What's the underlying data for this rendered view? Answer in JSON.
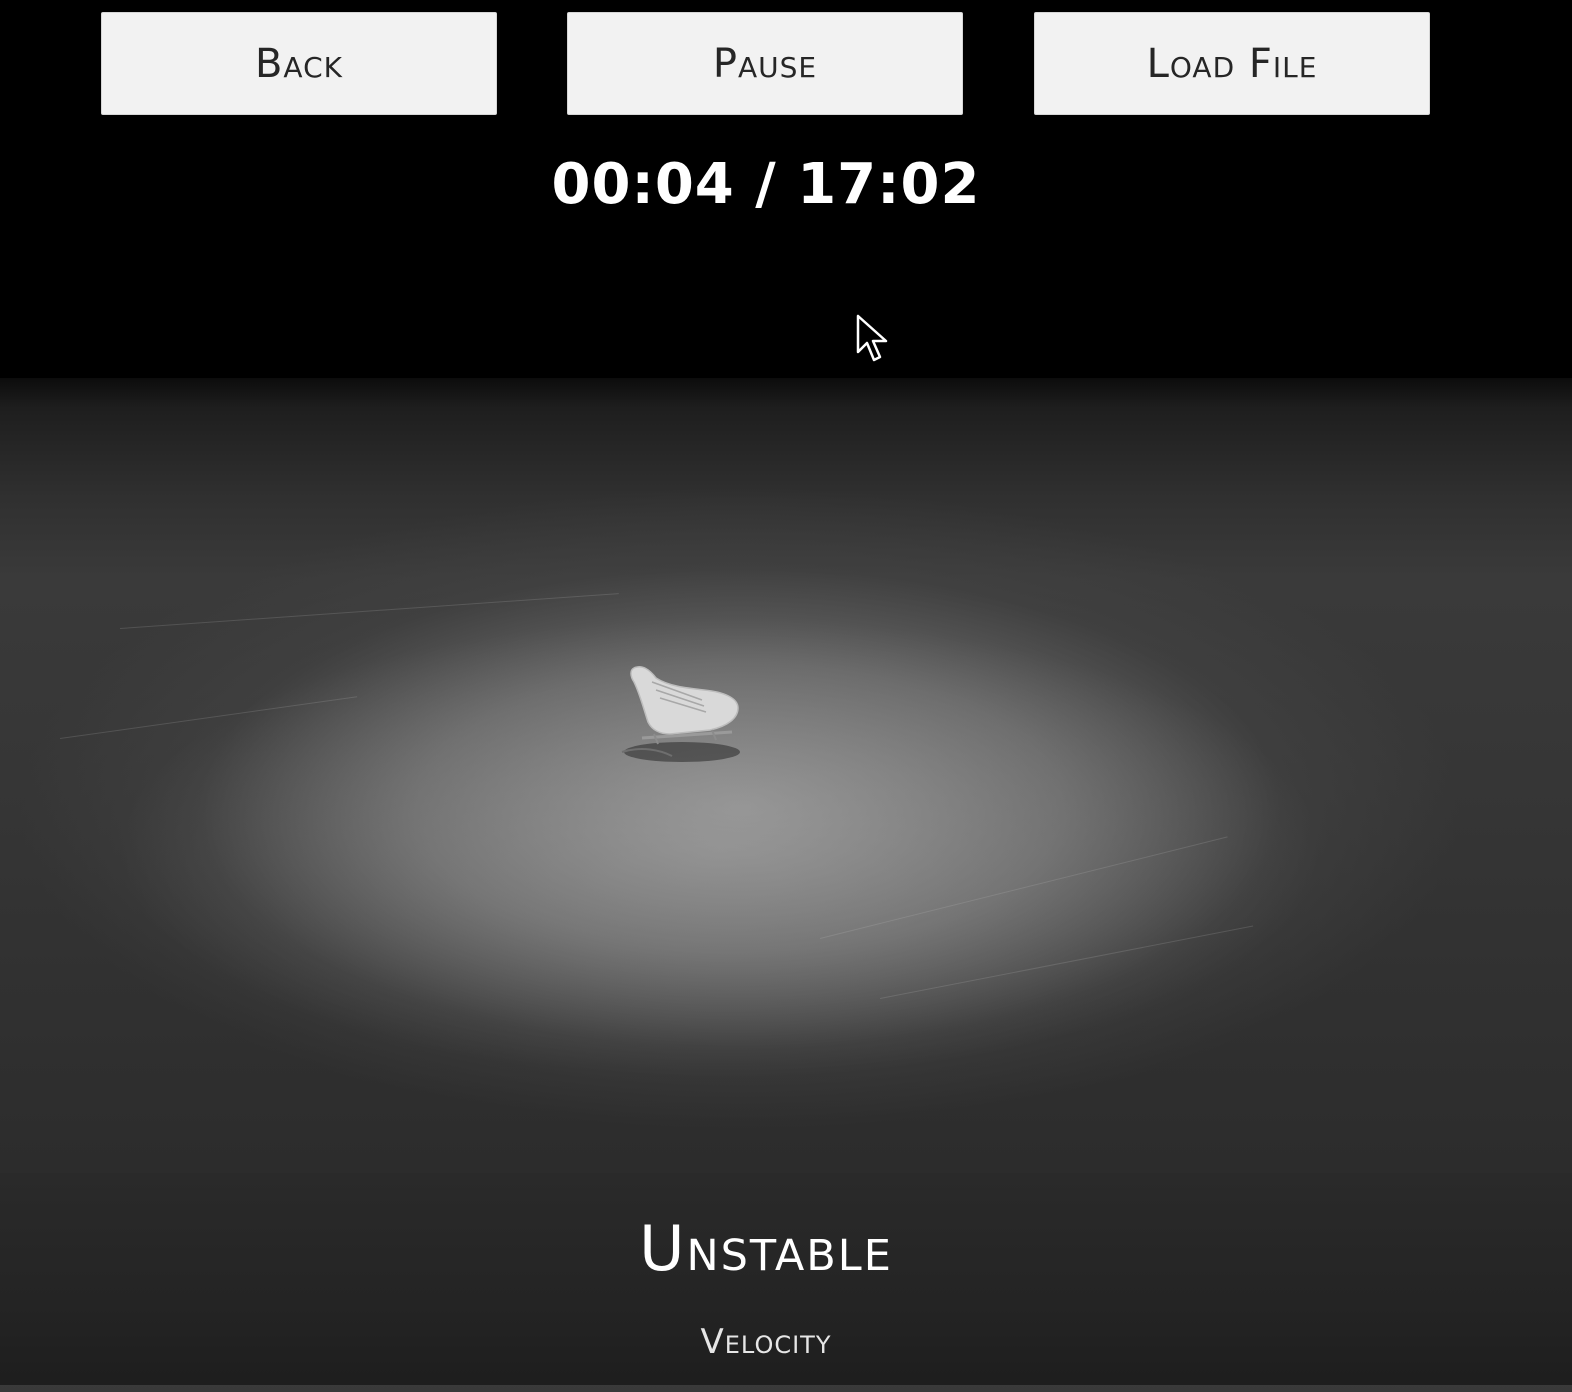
{
  "toolbar": {
    "back_label": "Back",
    "pause_label": "Pause",
    "load_file_label": "Load File"
  },
  "playback": {
    "timecode": "00:04 / 17:02"
  },
  "status": {
    "title": "Unstable",
    "subtitle": "Velocity"
  },
  "icons": {
    "cursor": "mouse-pointer-icon",
    "skate": "ice-skate-icon"
  },
  "colors": {
    "background": "#000000",
    "button_bg": "#f2f2f2",
    "button_text": "#262626",
    "text_light": "#ffffff"
  }
}
